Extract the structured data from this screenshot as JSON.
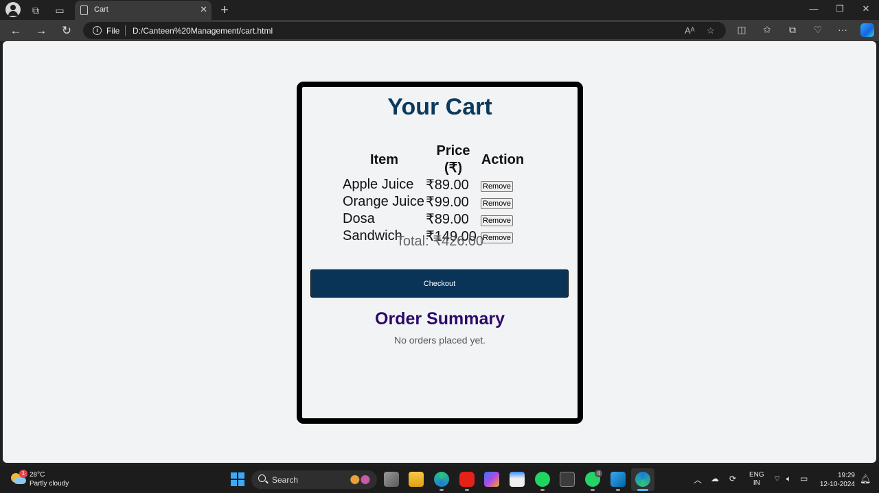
{
  "browser": {
    "tab_title": "Cart",
    "address_label": "File",
    "url": "D:/Canteen%20Management/cart.html"
  },
  "page": {
    "title": "Your Cart",
    "columns": [
      "Item",
      "Price (₹)",
      "Action"
    ],
    "items": [
      {
        "name": "Apple Juice",
        "price": "₹89.00",
        "action": "Remove"
      },
      {
        "name": "Orange Juice",
        "price": "₹99.00",
        "action": "Remove"
      },
      {
        "name": "Dosa",
        "price": "₹89.00",
        "action": "Remove"
      },
      {
        "name": "Sandwich",
        "price": "₹149.00",
        "action": "Remove"
      }
    ],
    "total": "Total: ₹426.00",
    "checkout_label": "Checkout",
    "summary_title": "Order Summary",
    "summary_empty": "No orders placed yet.",
    "colors": {
      "title": "#0a3a5e",
      "checkout_bg": "#0a3358",
      "summary_title": "#2a0a6a"
    }
  },
  "taskbar": {
    "weather_badge": "1",
    "temperature": "28°C",
    "condition": "Partly cloudy",
    "search_placeholder": "Search",
    "whatsapp_badge": "4",
    "lang_line1": "ENG",
    "lang_line2": "IN",
    "time": "19:29",
    "date": "12-10-2024"
  }
}
